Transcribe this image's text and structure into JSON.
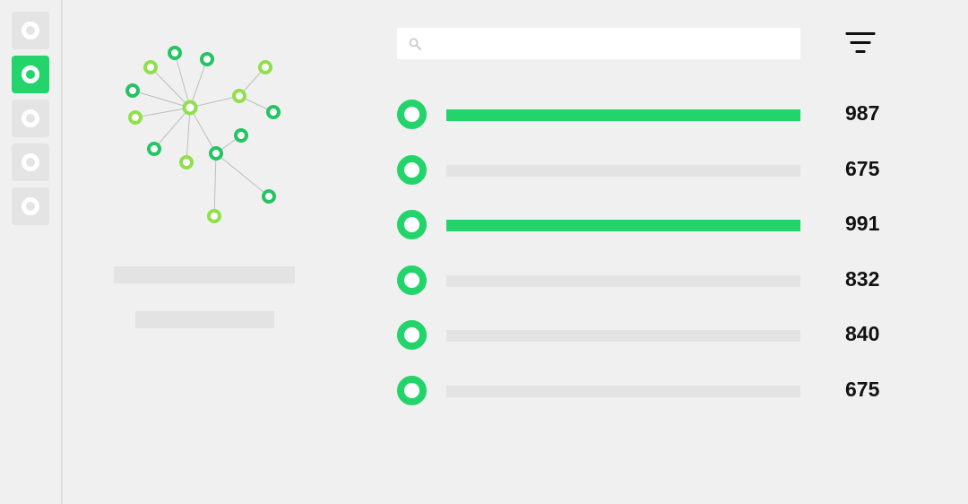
{
  "sidebar": {
    "items": [
      {
        "name": "nav-item-1",
        "active": false
      },
      {
        "name": "nav-item-2",
        "active": true
      },
      {
        "name": "nav-item-3",
        "active": false
      },
      {
        "name": "nav-item-4",
        "active": false
      },
      {
        "name": "nav-item-5",
        "active": false
      }
    ]
  },
  "search": {
    "value": "",
    "placeholder": "",
    "icon": "search-icon"
  },
  "filter": {
    "icon": "filter-icon"
  },
  "graph": {
    "icon": "network-graph",
    "colors": {
      "dark": "#22c463",
      "light": "#8fe04a",
      "edge": "#bdbdbd"
    }
  },
  "list": {
    "rows": [
      {
        "value": "987",
        "highlighted": true
      },
      {
        "value": "675",
        "highlighted": false
      },
      {
        "value": "991",
        "highlighted": true
      },
      {
        "value": "832",
        "highlighted": false
      },
      {
        "value": "840",
        "highlighted": false
      },
      {
        "value": "675",
        "highlighted": false
      }
    ]
  },
  "colors": {
    "accent": "#22d46a",
    "background": "#f0f0f0",
    "placeholder": "#e3e3e3",
    "text": "#111111"
  }
}
